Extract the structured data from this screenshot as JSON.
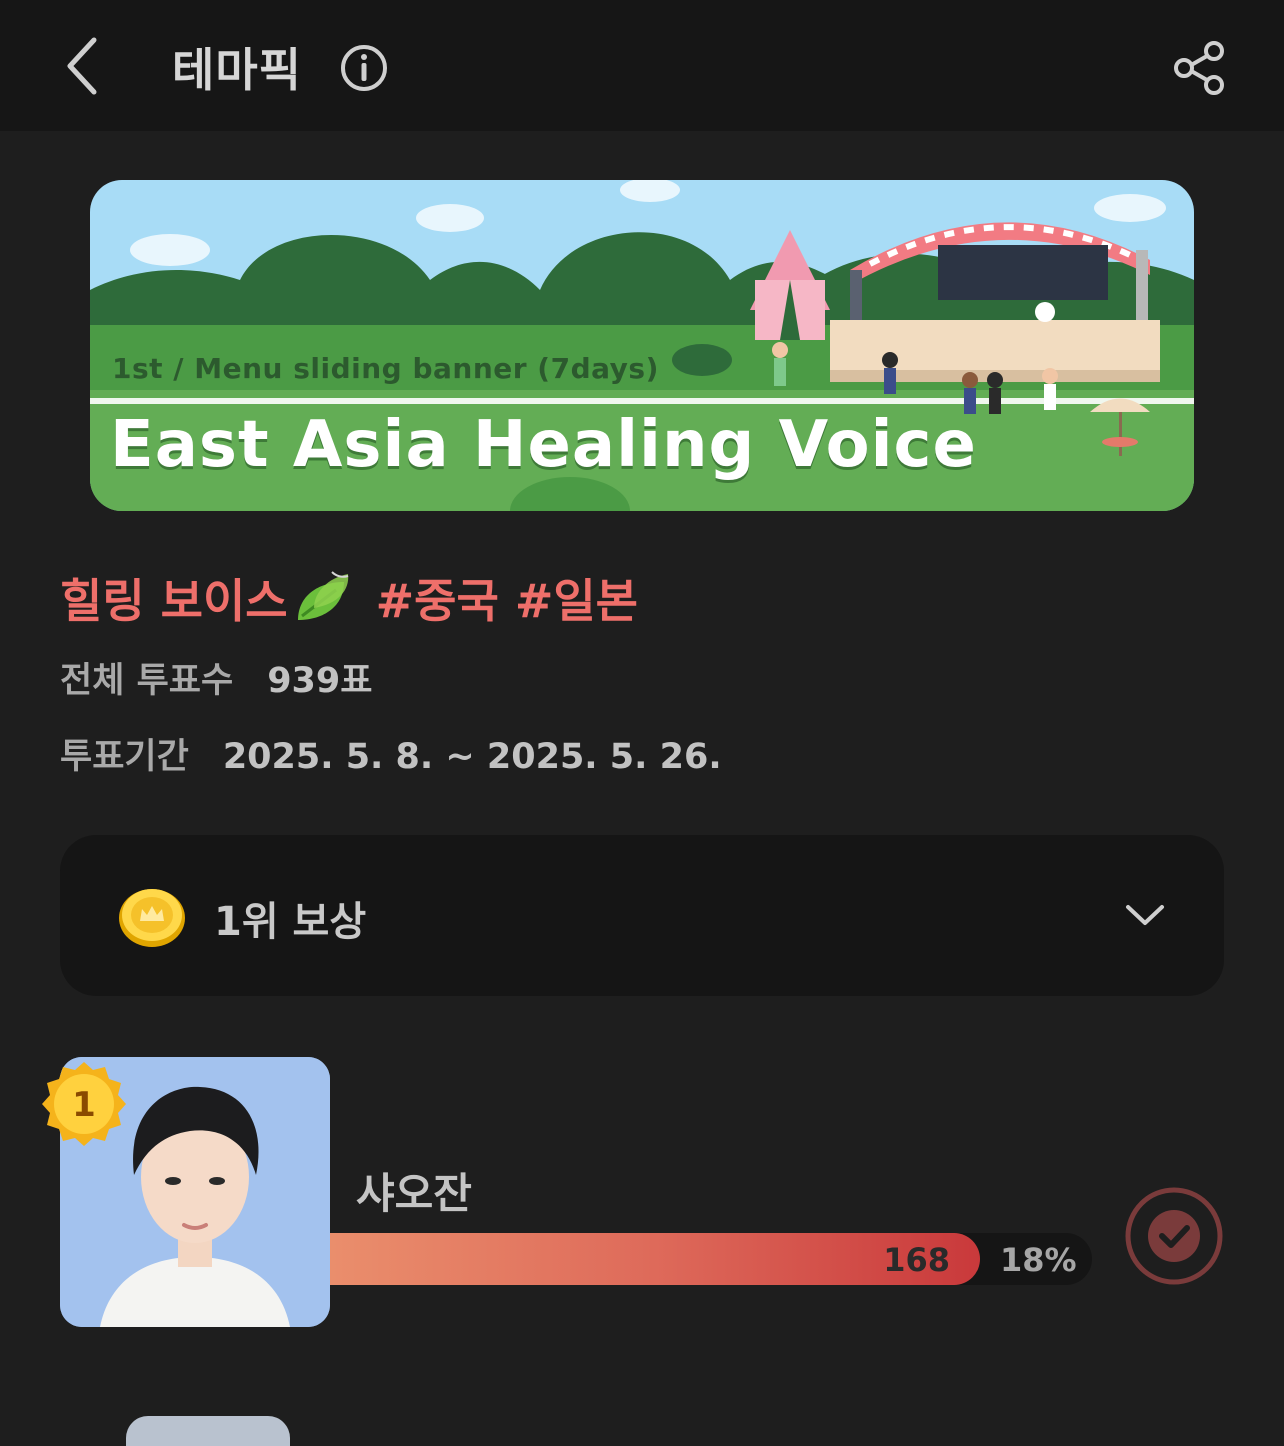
{
  "header": {
    "title": "테마픽",
    "back_icon": "chevron-left-icon",
    "info_icon": "info-icon",
    "share_icon": "share-icon"
  },
  "banner": {
    "subtitle": "1st / Menu sliding banner (7days)",
    "title": "East Asia Healing Voice"
  },
  "theme": {
    "headline": "힐링 보이스",
    "tags": "#중국 #일본",
    "total_votes_label": "전체 투표수",
    "total_votes_value": "939표",
    "period_label": "투표기간",
    "period_value": "2025. 5. 8. ~ 2025. 5. 26."
  },
  "reward": {
    "label": "1위 보상",
    "icon": "coin-icon",
    "toggle_icon": "chevron-down-icon"
  },
  "ranking": [
    {
      "rank": "1",
      "name": "샤오잔",
      "votes": "168",
      "percent": "18%",
      "share": 0.18
    }
  ],
  "colors": {
    "accent": "#ee6f6a",
    "background": "#1e1e1e",
    "topbar": "#161616",
    "card": "#151515"
  }
}
